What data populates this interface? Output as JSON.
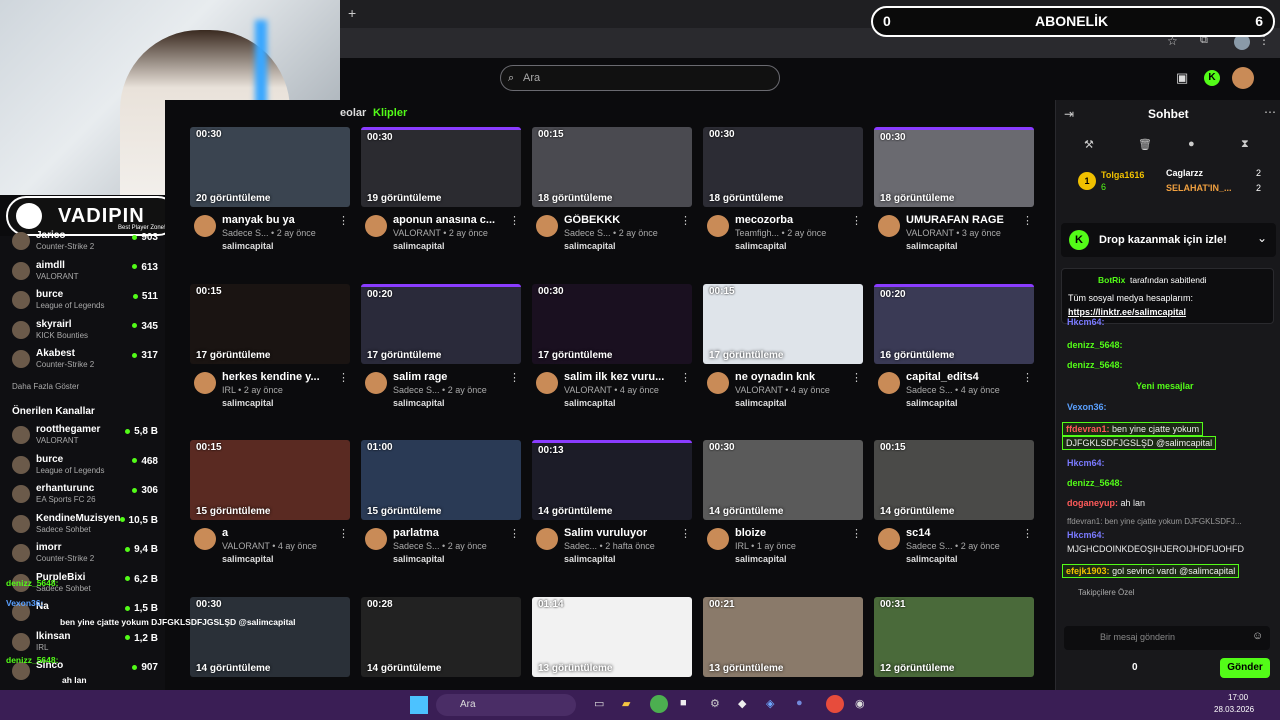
{
  "overlay": {
    "counter_left": "0",
    "title": "ABONELİK",
    "counter_right": "6",
    "logo_text": "VADIPIN",
    "logo_sub": "Best Player Zone!"
  },
  "browser": {
    "new_tab": "+"
  },
  "search": {
    "placeholder": "Ara"
  },
  "tabs": {
    "videos": "eolar",
    "clips": "Klipler"
  },
  "sidebar": {
    "top_channels": [
      {
        "name": "Jarico",
        "game": "Counter-Strike 2",
        "viewers": "903"
      },
      {
        "name": "aimdll",
        "game": "VALORANT",
        "viewers": "613"
      },
      {
        "name": "burce",
        "game": "League of Legends",
        "viewers": "511"
      },
      {
        "name": "skyrairl",
        "game": "KICK Bounties",
        "viewers": "345"
      },
      {
        "name": "Akabest",
        "game": "Counter-Strike 2",
        "viewers": "317"
      }
    ],
    "show_more": "Daha Fazla Göster",
    "recommended_title": "Önerilen Kanallar",
    "recommended": [
      {
        "name": "rootthegamer",
        "game": "VALORANT",
        "viewers": "5,8 B"
      },
      {
        "name": "burce",
        "game": "League of Legends",
        "viewers": "468"
      },
      {
        "name": "erhanturunc",
        "game": "EA Sports FC 26",
        "viewers": "306"
      },
      {
        "name": "KendineMuzisyen",
        "game": "Sadece Sohbet",
        "viewers": "10,5 B"
      },
      {
        "name": "imorr",
        "game": "Counter-Strike 2",
        "viewers": "9,4 B"
      },
      {
        "name": "PurpleBixi",
        "game": "Sadece Sohbet",
        "viewers": "6,2 B"
      },
      {
        "name": "Na",
        "game": "",
        "viewers": "1,5 B"
      },
      {
        "name": "lkinsan",
        "game": "IRL",
        "viewers": "1,2 B"
      },
      {
        "name": "Sinco",
        "game": "",
        "viewers": "907"
      }
    ]
  },
  "clips": [
    {
      "dur": "00:30",
      "views": "20 görüntüleme",
      "title": "manyak bu ya",
      "cat": "Sadece S...",
      "ago": "2 ay önce",
      "chan": "salimcapital"
    },
    {
      "dur": "00:30",
      "views": "19 görüntüleme",
      "title": "aponun anasına c...",
      "cat": "VALORANT",
      "ago": "2 ay önce",
      "chan": "salimcapital"
    },
    {
      "dur": "00:15",
      "views": "18 görüntüleme",
      "title": "GÖBEKKK",
      "cat": "Sadece S...",
      "ago": "2 ay önce",
      "chan": "salimcapital"
    },
    {
      "dur": "00:30",
      "views": "18 görüntüleme",
      "title": "mecozorba",
      "cat": "Teamfigh...",
      "ago": "2 ay önce",
      "chan": "salimcapital"
    },
    {
      "dur": "00:30",
      "views": "18 görüntüleme",
      "title": "UMURAFAN RAGE",
      "cat": "VALORANT",
      "ago": "3 ay önce",
      "chan": "salimcapital"
    },
    {
      "dur": "00:15",
      "views": "17 görüntüleme",
      "title": "herkes kendine y...",
      "cat": "IRL",
      "ago": "2 ay önce",
      "chan": "salimcapital"
    },
    {
      "dur": "00:20",
      "views": "17 görüntüleme",
      "title": "salim rage",
      "cat": "Sadece S...",
      "ago": "2 ay önce",
      "chan": "salimcapital"
    },
    {
      "dur": "00:30",
      "views": "17 görüntüleme",
      "title": "salim ilk kez vuru...",
      "cat": "VALORANT",
      "ago": "4 ay önce",
      "chan": "salimcapital"
    },
    {
      "dur": "00:15",
      "views": "17 görüntüleme",
      "title": "ne oynadın knk",
      "cat": "VALORANT",
      "ago": "4 ay önce",
      "chan": "salimcapital"
    },
    {
      "dur": "00:20",
      "views": "16 görüntüleme",
      "title": "capital_edits4",
      "cat": "Sadece S...",
      "ago": "4 ay önce",
      "chan": "salimcapital"
    },
    {
      "dur": "00:15",
      "views": "15 görüntüleme",
      "title": "a",
      "cat": "VALORANT",
      "ago": "4 ay önce",
      "chan": "salimcapital"
    },
    {
      "dur": "01:00",
      "views": "15 görüntüleme",
      "title": "parlatma",
      "cat": "Sadece S...",
      "ago": "2 ay önce",
      "chan": "salimcapital"
    },
    {
      "dur": "00:13",
      "views": "14 görüntüleme",
      "title": "Salim vuruluyor",
      "cat": "Sadec...",
      "ago": "2 hafta önce",
      "chan": "salimcapital"
    },
    {
      "dur": "00:30",
      "views": "14 görüntüleme",
      "title": "bloize",
      "cat": "IRL",
      "ago": "1 ay önce",
      "chan": "salimcapital"
    },
    {
      "dur": "00:15",
      "views": "14 görüntüleme",
      "title": "sc14",
      "cat": "Sadece S...",
      "ago": "2 ay önce",
      "chan": "salimcapital"
    },
    {
      "dur": "00:30",
      "views": "14 görüntüleme",
      "title": "",
      "cat": "",
      "ago": "",
      "chan": ""
    },
    {
      "dur": "00:28",
      "views": "14 görüntüleme",
      "title": "",
      "cat": "",
      "ago": "",
      "chan": ""
    },
    {
      "dur": "01:14",
      "views": "13 görüntüleme",
      "title": "",
      "cat": "",
      "ago": "",
      "chan": ""
    },
    {
      "dur": "00:21",
      "views": "13 görüntüleme",
      "title": "",
      "cat": "",
      "ago": "",
      "chan": ""
    },
    {
      "dur": "00:31",
      "views": "12 görüntüleme",
      "title": "",
      "cat": "",
      "ago": "",
      "chan": ""
    }
  ],
  "chat": {
    "title": "Sohbet",
    "leader1": {
      "rank": "1",
      "name": "Tolga1616",
      "count": "6"
    },
    "leader2": {
      "name": "Caglarzz",
      "count": "2"
    },
    "leader3": {
      "name": "SELAHAT'IN_...",
      "count": "2"
    },
    "drop_text": "Drop kazanmak için izle!",
    "pinned_by": "BotRix",
    "pinned_label": "tarafından sabitlendi",
    "pinned_msg": "Tüm sosyal medya hesaplarım:",
    "pinned_link": "https://linktr.ee/salimcapital",
    "new_messages": "Yeni mesajlar",
    "messages": [
      {
        "user": "Hkcm64:",
        "text": ""
      },
      {
        "user": "denizz_5648:",
        "text": ""
      },
      {
        "user": "denizz_5648:",
        "text": ""
      },
      {
        "user": "Vexon36:",
        "text": ""
      },
      {
        "user": "ffdevran1:",
        "text": "ben yine cjatte yokum"
      },
      {
        "user": "",
        "text": "DJFGKLSDFJGSLŞD @salimcapital"
      },
      {
        "user": "Hkcm64:",
        "text": ""
      },
      {
        "user": "denizz_5648:",
        "text": ""
      },
      {
        "user": "doganeyup:",
        "text": "ah lan"
      },
      {
        "user": "",
        "text": "ffdevran1: ben yine cjatte yokum DJFGKLSDFJ..."
      },
      {
        "user": "Hkcm64:",
        "text": ""
      },
      {
        "user": "",
        "text": "MJGHCDOINKDEOŞIHJEROIJHDFIJOHFD"
      },
      {
        "user": "efejk1903:",
        "text": "gol sevinci vardı @salimcapital"
      }
    ],
    "follower_special": "Takipçilere Özel",
    "input_placeholder": "Bir mesaj gönderin",
    "count_zero": "0",
    "send": "Gönder"
  },
  "overlay_chat": [
    {
      "text": "denizz_5648:"
    },
    {
      "text": "Vexon36:"
    },
    {
      "text": "ben yine cjatte yokum DJFGKLSDFJGSLŞD @salimcapital"
    },
    {
      "text": "denizz_5648:"
    },
    {
      "text": "ah lan"
    },
    {
      "text": "MJGHCDOINKDEOŞIHJEROIJHDFIJOHFD"
    },
    {
      "text": "efejk1903: gol sevinci vardı @salimcapital"
    }
  ],
  "taskbar": {
    "search": "Ara",
    "time": "17:00",
    "date": "28.03.2026"
  },
  "colors": {
    "accent": "#53fc18",
    "taskbar": "#3a1e55"
  }
}
